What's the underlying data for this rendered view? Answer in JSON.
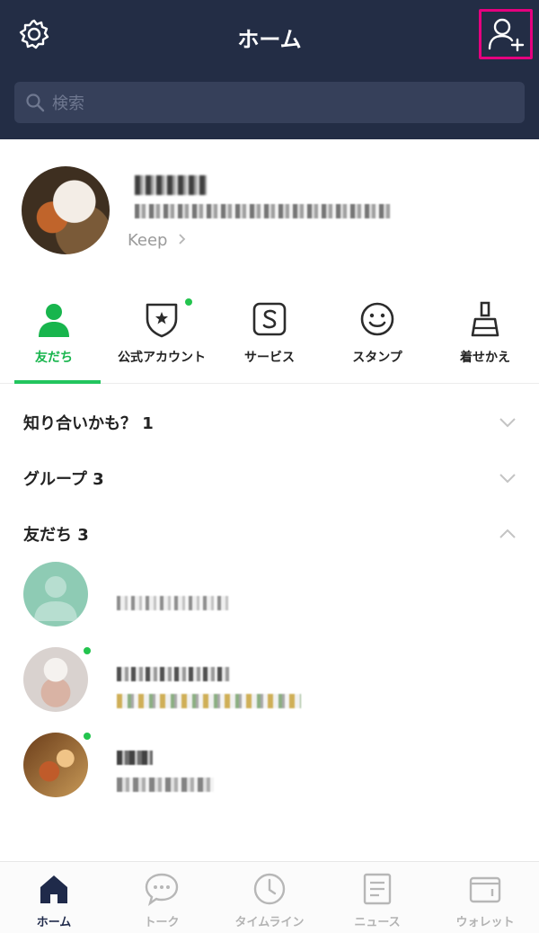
{
  "header": {
    "title": "ホーム",
    "search_placeholder": "検索",
    "icons": {
      "settings": "gear-icon",
      "add_friend": "add-friend-icon",
      "search": "search-icon"
    },
    "colors": {
      "bg": "#232d45",
      "highlight": "#e5007f"
    }
  },
  "profile": {
    "keep_label": "Keep"
  },
  "services": [
    {
      "label": "友だち",
      "icon": "person-icon",
      "active": true
    },
    {
      "label": "公式アカウント",
      "icon": "shield-star-icon",
      "new_dot": true
    },
    {
      "label": "サービス",
      "icon": "s-box-icon"
    },
    {
      "label": "スタンプ",
      "icon": "smile-icon"
    },
    {
      "label": "着せかえ",
      "icon": "brush-icon"
    }
  ],
  "sections": [
    {
      "label": "知り合いかも？ 1",
      "state": "collapsed"
    },
    {
      "label": "グループ 3",
      "state": "collapsed"
    },
    {
      "label": "友だち 3",
      "state": "expanded"
    }
  ],
  "bottom_nav": [
    {
      "label": "ホーム",
      "icon": "home-icon",
      "active": true
    },
    {
      "label": "トーク",
      "icon": "chat-icon"
    },
    {
      "label": "タイムライン",
      "icon": "clock-icon"
    },
    {
      "label": "ニュース",
      "icon": "news-icon"
    },
    {
      "label": "ウォレット",
      "icon": "wallet-icon"
    }
  ],
  "colors": {
    "accent_green": "#22c55e"
  }
}
